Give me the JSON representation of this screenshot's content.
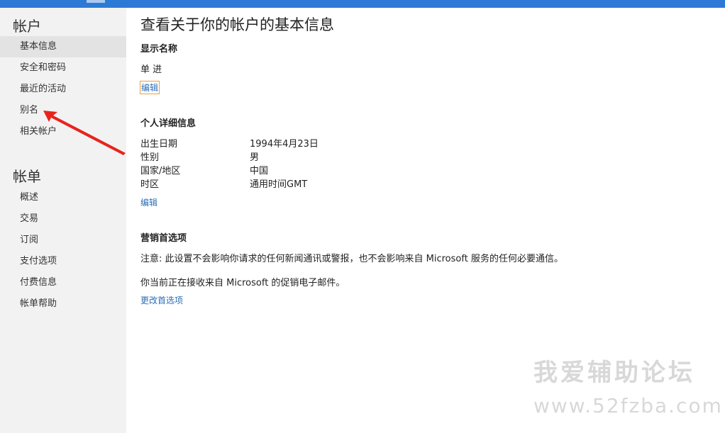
{
  "sidebar": {
    "account_heading": "帐户",
    "account_items": [
      {
        "label": "基本信息",
        "active": true
      },
      {
        "label": "安全和密码"
      },
      {
        "label": "最近的活动"
      },
      {
        "label": "别名"
      },
      {
        "label": "相关帐户"
      }
    ],
    "billing_heading": "帐单",
    "billing_items": [
      {
        "label": "概述"
      },
      {
        "label": "交易"
      },
      {
        "label": "订阅"
      },
      {
        "label": "支付选项"
      },
      {
        "label": "付费信息"
      },
      {
        "label": "帐单帮助"
      }
    ]
  },
  "main": {
    "title": "查看关于你的帐户的基本信息",
    "display_name": {
      "heading": "显示名称",
      "value": "单 进",
      "edit_label": "编辑"
    },
    "personal_details": {
      "heading": "个人详细信息",
      "rows": [
        {
          "label": "出生日期",
          "value": "1994年4月23日"
        },
        {
          "label": "性别",
          "value": "男"
        },
        {
          "label": "国家/地区",
          "value": "中国"
        },
        {
          "label": "时区",
          "value": "通用时间GMT"
        }
      ],
      "edit_label": "编辑"
    },
    "marketing": {
      "heading": "营销首选项",
      "note": "注意: 此设置不会影响你请求的任何新闻通讯或警报，也不会影响来自 Microsoft 服务的任何必要通信。",
      "status": "你当前正在接收来自 Microsoft 的促销电子邮件。",
      "change_label": "更改首选项"
    }
  },
  "watermark": {
    "logo_text": "我爱辅助论坛",
    "url_text": "www.52fzba.com"
  },
  "colors": {
    "topbar": "#2d7ad6",
    "sidebar_bg": "#f2f2f2",
    "link": "#2a6ebb",
    "annotation_arrow": "#e8231e"
  }
}
